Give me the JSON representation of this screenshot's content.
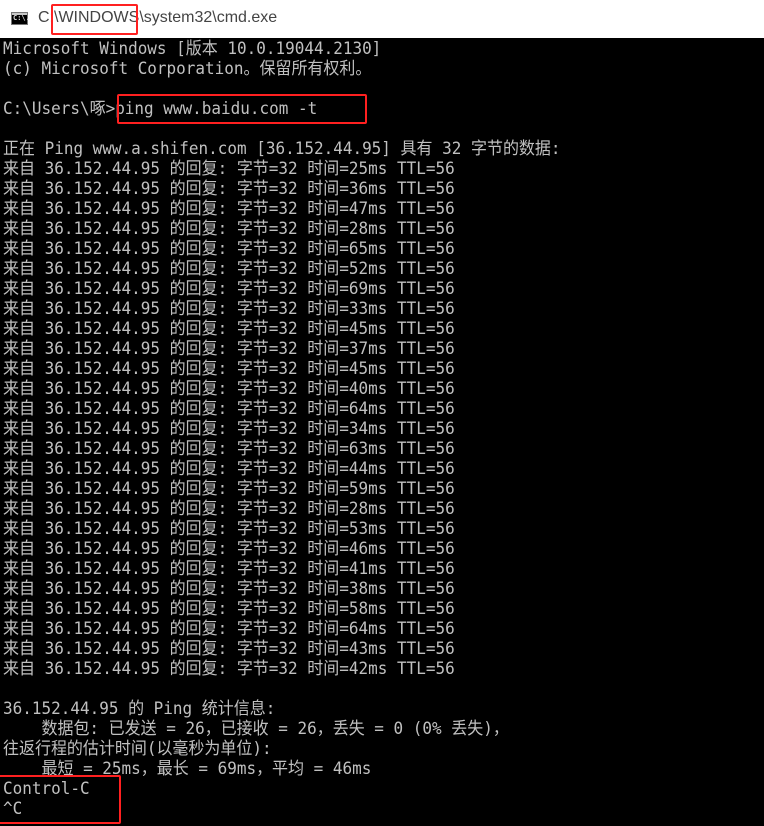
{
  "window": {
    "title_prefix": "C:\\",
    "title_highlight": "WINDOWS",
    "title_suffix": "\\system32\\cmd.exe",
    "icon_text": "C:\\."
  },
  "console": {
    "lines": [
      "Microsoft Windows [版本 10.0.19044.2130]",
      "(c) Microsoft Corporation。保留所有权利。",
      "",
      "C:\\Users\\啄>ping www.baidu.com -t",
      "",
      "正在 Ping www.a.shifen.com [36.152.44.95] 具有 32 字节的数据:",
      "来自 36.152.44.95 的回复: 字节=32 时间=25ms TTL=56",
      "来自 36.152.44.95 的回复: 字节=32 时间=36ms TTL=56",
      "来自 36.152.44.95 的回复: 字节=32 时间=47ms TTL=56",
      "来自 36.152.44.95 的回复: 字节=32 时间=28ms TTL=56",
      "来自 36.152.44.95 的回复: 字节=32 时间=65ms TTL=56",
      "来自 36.152.44.95 的回复: 字节=32 时间=52ms TTL=56",
      "来自 36.152.44.95 的回复: 字节=32 时间=69ms TTL=56",
      "来自 36.152.44.95 的回复: 字节=32 时间=33ms TTL=56",
      "来自 36.152.44.95 的回复: 字节=32 时间=45ms TTL=56",
      "来自 36.152.44.95 的回复: 字节=32 时间=37ms TTL=56",
      "来自 36.152.44.95 的回复: 字节=32 时间=45ms TTL=56",
      "来自 36.152.44.95 的回复: 字节=32 时间=40ms TTL=56",
      "来自 36.152.44.95 的回复: 字节=32 时间=64ms TTL=56",
      "来自 36.152.44.95 的回复: 字节=32 时间=34ms TTL=56",
      "来自 36.152.44.95 的回复: 字节=32 时间=63ms TTL=56",
      "来自 36.152.44.95 的回复: 字节=32 时间=44ms TTL=56",
      "来自 36.152.44.95 的回复: 字节=32 时间=59ms TTL=56",
      "来自 36.152.44.95 的回复: 字节=32 时间=28ms TTL=56",
      "来自 36.152.44.95 的回复: 字节=32 时间=53ms TTL=56",
      "来自 36.152.44.95 的回复: 字节=32 时间=46ms TTL=56",
      "来自 36.152.44.95 的回复: 字节=32 时间=41ms TTL=56",
      "来自 36.152.44.95 的回复: 字节=32 时间=38ms TTL=56",
      "来自 36.152.44.95 的回复: 字节=32 时间=58ms TTL=56",
      "来自 36.152.44.95 的回复: 字节=32 时间=64ms TTL=56",
      "来自 36.152.44.95 的回复: 字节=32 时间=43ms TTL=56",
      "来自 36.152.44.95 的回复: 字节=32 时间=42ms TTL=56",
      "",
      "36.152.44.95 的 Ping 统计信息:",
      "    数据包: 已发送 = 26，已接收 = 26，丢失 = 0 (0% 丢失)，",
      "往返行程的估计时间(以毫秒为单位):",
      "    最短 = 25ms，最长 = 69ms，平均 = 46ms",
      "Control-C",
      "^C"
    ]
  },
  "colors": {
    "terminal_bg": "#000000",
    "terminal_text": "#c0c0c0",
    "highlight": "#ff2020"
  }
}
